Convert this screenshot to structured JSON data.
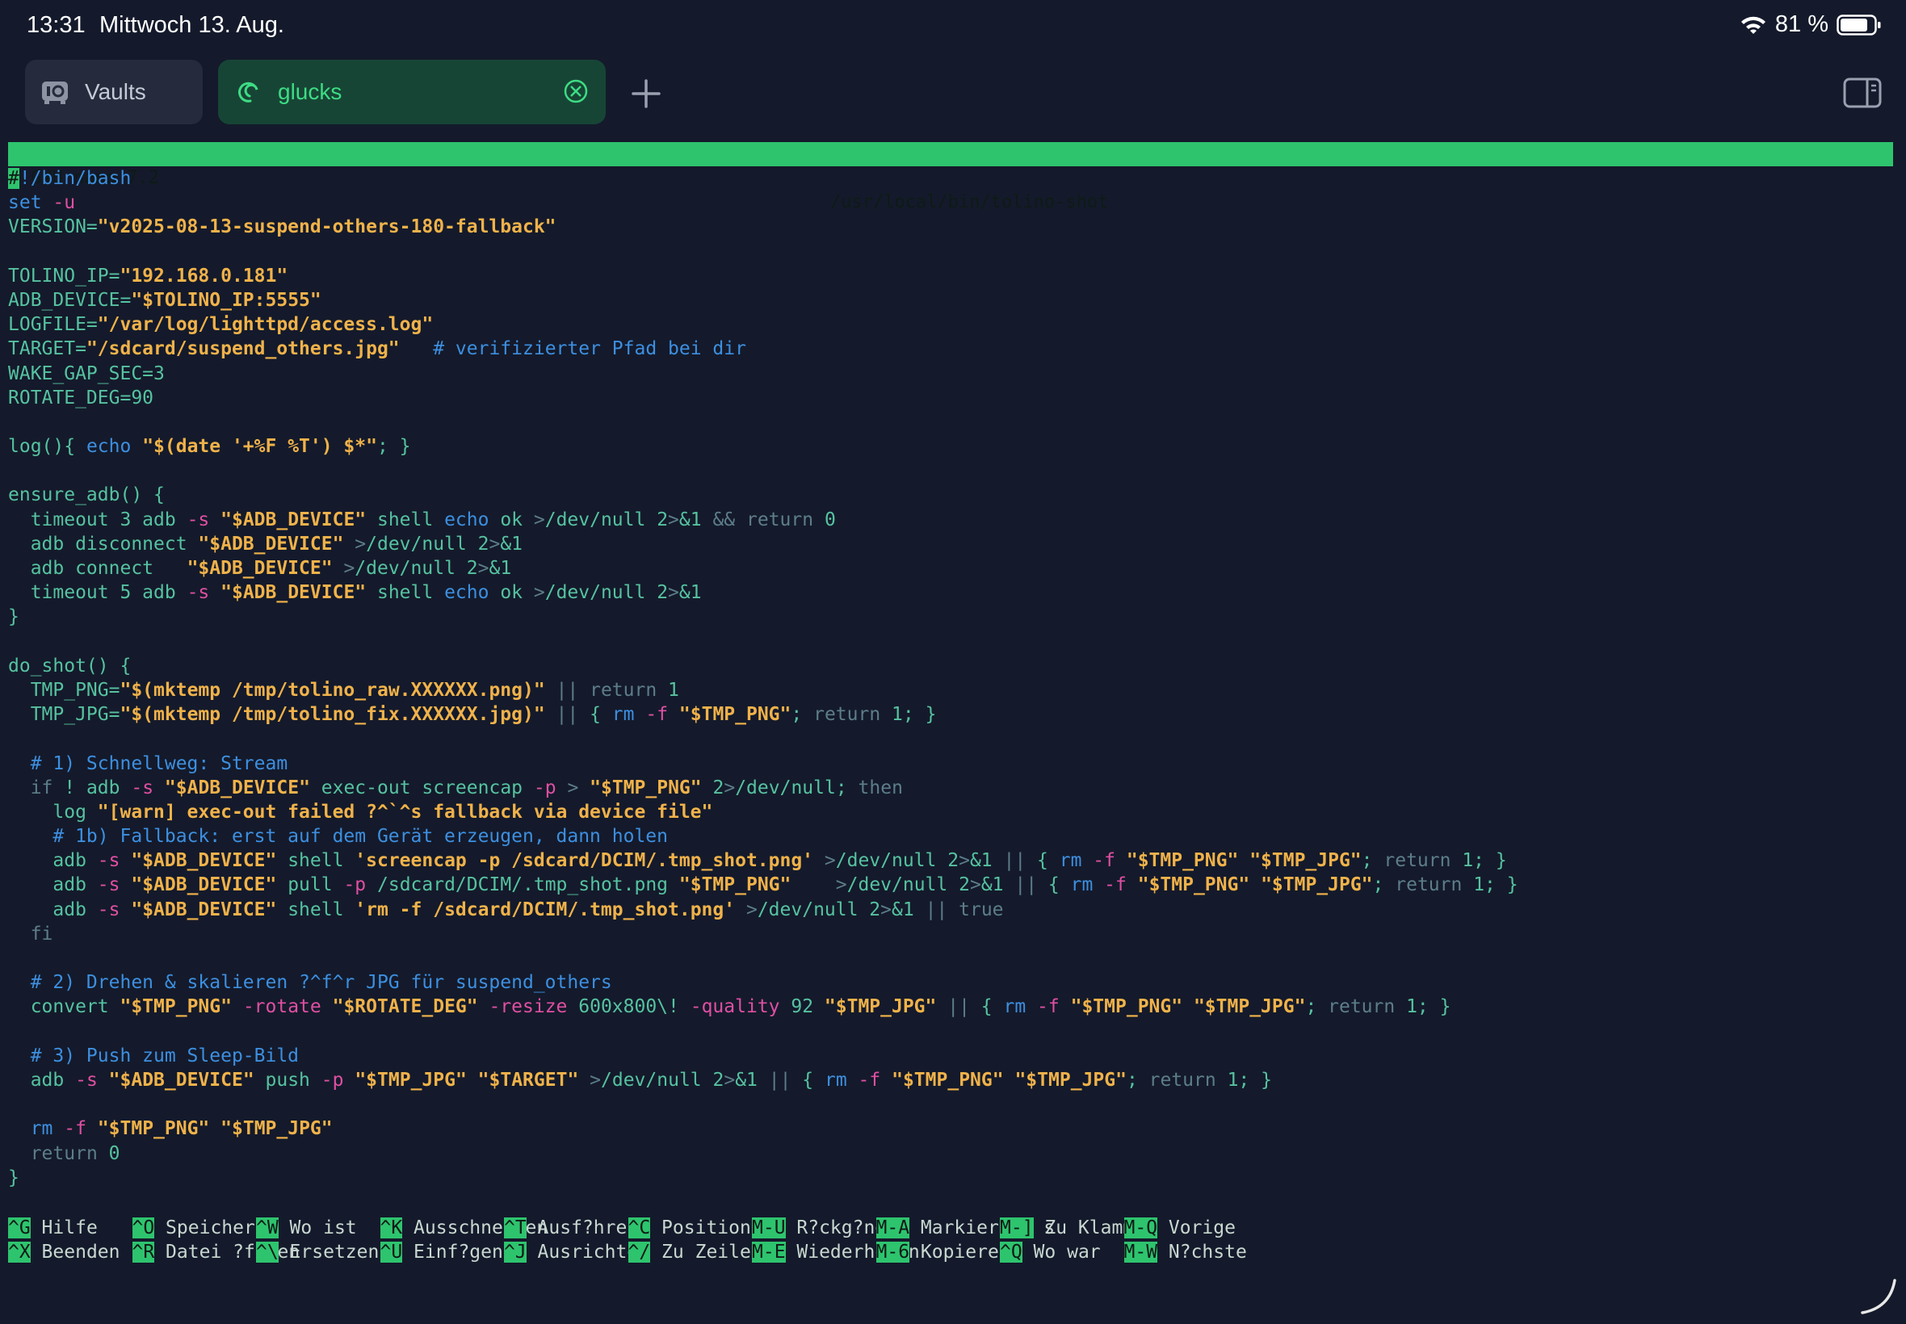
{
  "status": {
    "time": "13:31",
    "date": "Mittwoch 13. Aug.",
    "battery": "81 %"
  },
  "tabs": [
    {
      "label": "Vaults"
    },
    {
      "label": "glucks"
    }
  ],
  "nano": {
    "version": "GNU nano 7.2",
    "file": "/usr/local/bin/tolino-shot"
  },
  "lines": [
    "#!/bin/bash",
    "set -u",
    "VERSION=\"v2025-08-13-suspend-others-180-fallback\"",
    "",
    "TOLINO_IP=\"192.168.0.181\"",
    "ADB_DEVICE=\"$TOLINO_IP:5555\"",
    "LOGFILE=\"/var/log/lighttpd/access.log\"",
    "TARGET=\"/sdcard/suspend_others.jpg\"   # verifizierter Pfad bei dir",
    "WAKE_GAP_SEC=3",
    "ROTATE_DEG=90",
    "",
    "log(){ echo \"$(date '+%F %T') $*\"; }",
    "",
    "ensure_adb() {",
    "  timeout 3 adb -s \"$ADB_DEVICE\" shell echo ok >/dev/null 2>&1 && return 0",
    "  adb disconnect \"$ADB_DEVICE\" >/dev/null 2>&1",
    "  adb connect   \"$ADB_DEVICE\" >/dev/null 2>&1",
    "  timeout 5 adb -s \"$ADB_DEVICE\" shell echo ok >/dev/null 2>&1",
    "}",
    "",
    "do_shot() {",
    "  TMP_PNG=\"$(mktemp /tmp/tolino_raw.XXXXXX.png)\" || return 1",
    "  TMP_JPG=\"$(mktemp /tmp/tolino_fix.XXXXXX.jpg)\" || { rm -f \"$TMP_PNG\"; return 1; }",
    "",
    "  # 1) Schnellweg: Stream",
    "  if ! adb -s \"$ADB_DEVICE\" exec-out screencap -p > \"$TMP_PNG\" 2>/dev/null; then",
    "    log \"[warn] exec-out failed ?^`^s fallback via device file\"",
    "    # 1b) Fallback: erst auf dem Gerät erzeugen, dann holen",
    "    adb -s \"$ADB_DEVICE\" shell 'screencap -p /sdcard/DCIM/.tmp_shot.png' >/dev/null 2>&1 || { rm -f \"$TMP_PNG\" \"$TMP_JPG\"; return 1; }",
    "    adb -s \"$ADB_DEVICE\" pull -p /sdcard/DCIM/.tmp_shot.png \"$TMP_PNG\"    >/dev/null 2>&1 || { rm -f \"$TMP_PNG\" \"$TMP_JPG\"; return 1; }",
    "    adb -s \"$ADB_DEVICE\" shell 'rm -f /sdcard/DCIM/.tmp_shot.png' >/dev/null 2>&1 || true",
    "  fi",
    "",
    "  # 2) Drehen & skalieren ?^f^r JPG für suspend_others",
    "  convert \"$TMP_PNG\" -rotate \"$ROTATE_DEG\" -resize 600x800\\! -quality 92 \"$TMP_JPG\" || { rm -f \"$TMP_PNG\" \"$TMP_JPG\"; return 1; }",
    "",
    "  # 3) Push zum Sleep-Bild",
    "  adb -s \"$ADB_DEVICE\" push -p \"$TMP_JPG\" \"$TARGET\" >/dev/null 2>&1 || { rm -f \"$TMP_PNG\" \"$TMP_JPG\"; return 1; }",
    "",
    "  rm -f \"$TMP_PNG\" \"$TMP_JPG\"",
    "  return 0",
    "}"
  ],
  "shortcuts": [
    [
      {
        "key": "^G",
        "label": "Hilfe"
      },
      {
        "key": "^O",
        "label": "Speichern"
      },
      {
        "key": "^W",
        "label": "Wo ist"
      },
      {
        "key": "^K",
        "label": "Ausschneiden"
      },
      {
        "key": "^T",
        "label": "Ausf?hren"
      },
      {
        "key": "^C",
        "label": "Position"
      },
      {
        "key": "M-U",
        "label": "R?ckg?ngig"
      },
      {
        "key": "M-A",
        "label": "Markierung s"
      },
      {
        "key": "M-]",
        "label": "Zu Klammer"
      },
      {
        "key": "M-Q",
        "label": "Vorige"
      }
    ],
    [
      {
        "key": "^X",
        "label": "Beenden"
      },
      {
        "key": "^R",
        "label": "Datei ?ffnen"
      },
      {
        "key": "^\\",
        "label": "Ersetzen"
      },
      {
        "key": "^U",
        "label": "Einf?gen"
      },
      {
        "key": "^J",
        "label": "Ausrichten"
      },
      {
        "key": "^/",
        "label": "Zu Zeile"
      },
      {
        "key": "M-E",
        "label": "Wiederholen"
      },
      {
        "key": "M-6",
        "label": "Kopieren"
      },
      {
        "key": "^Q",
        "label": "Wo war"
      },
      {
        "key": "M-W",
        "label": "N?chste"
      }
    ]
  ],
  "colors": {
    "background": "#141a2b",
    "accent": "#2ec46e",
    "string": "#f0b24a",
    "keyword": "#3d8fe0",
    "option": "#e04fa3"
  }
}
